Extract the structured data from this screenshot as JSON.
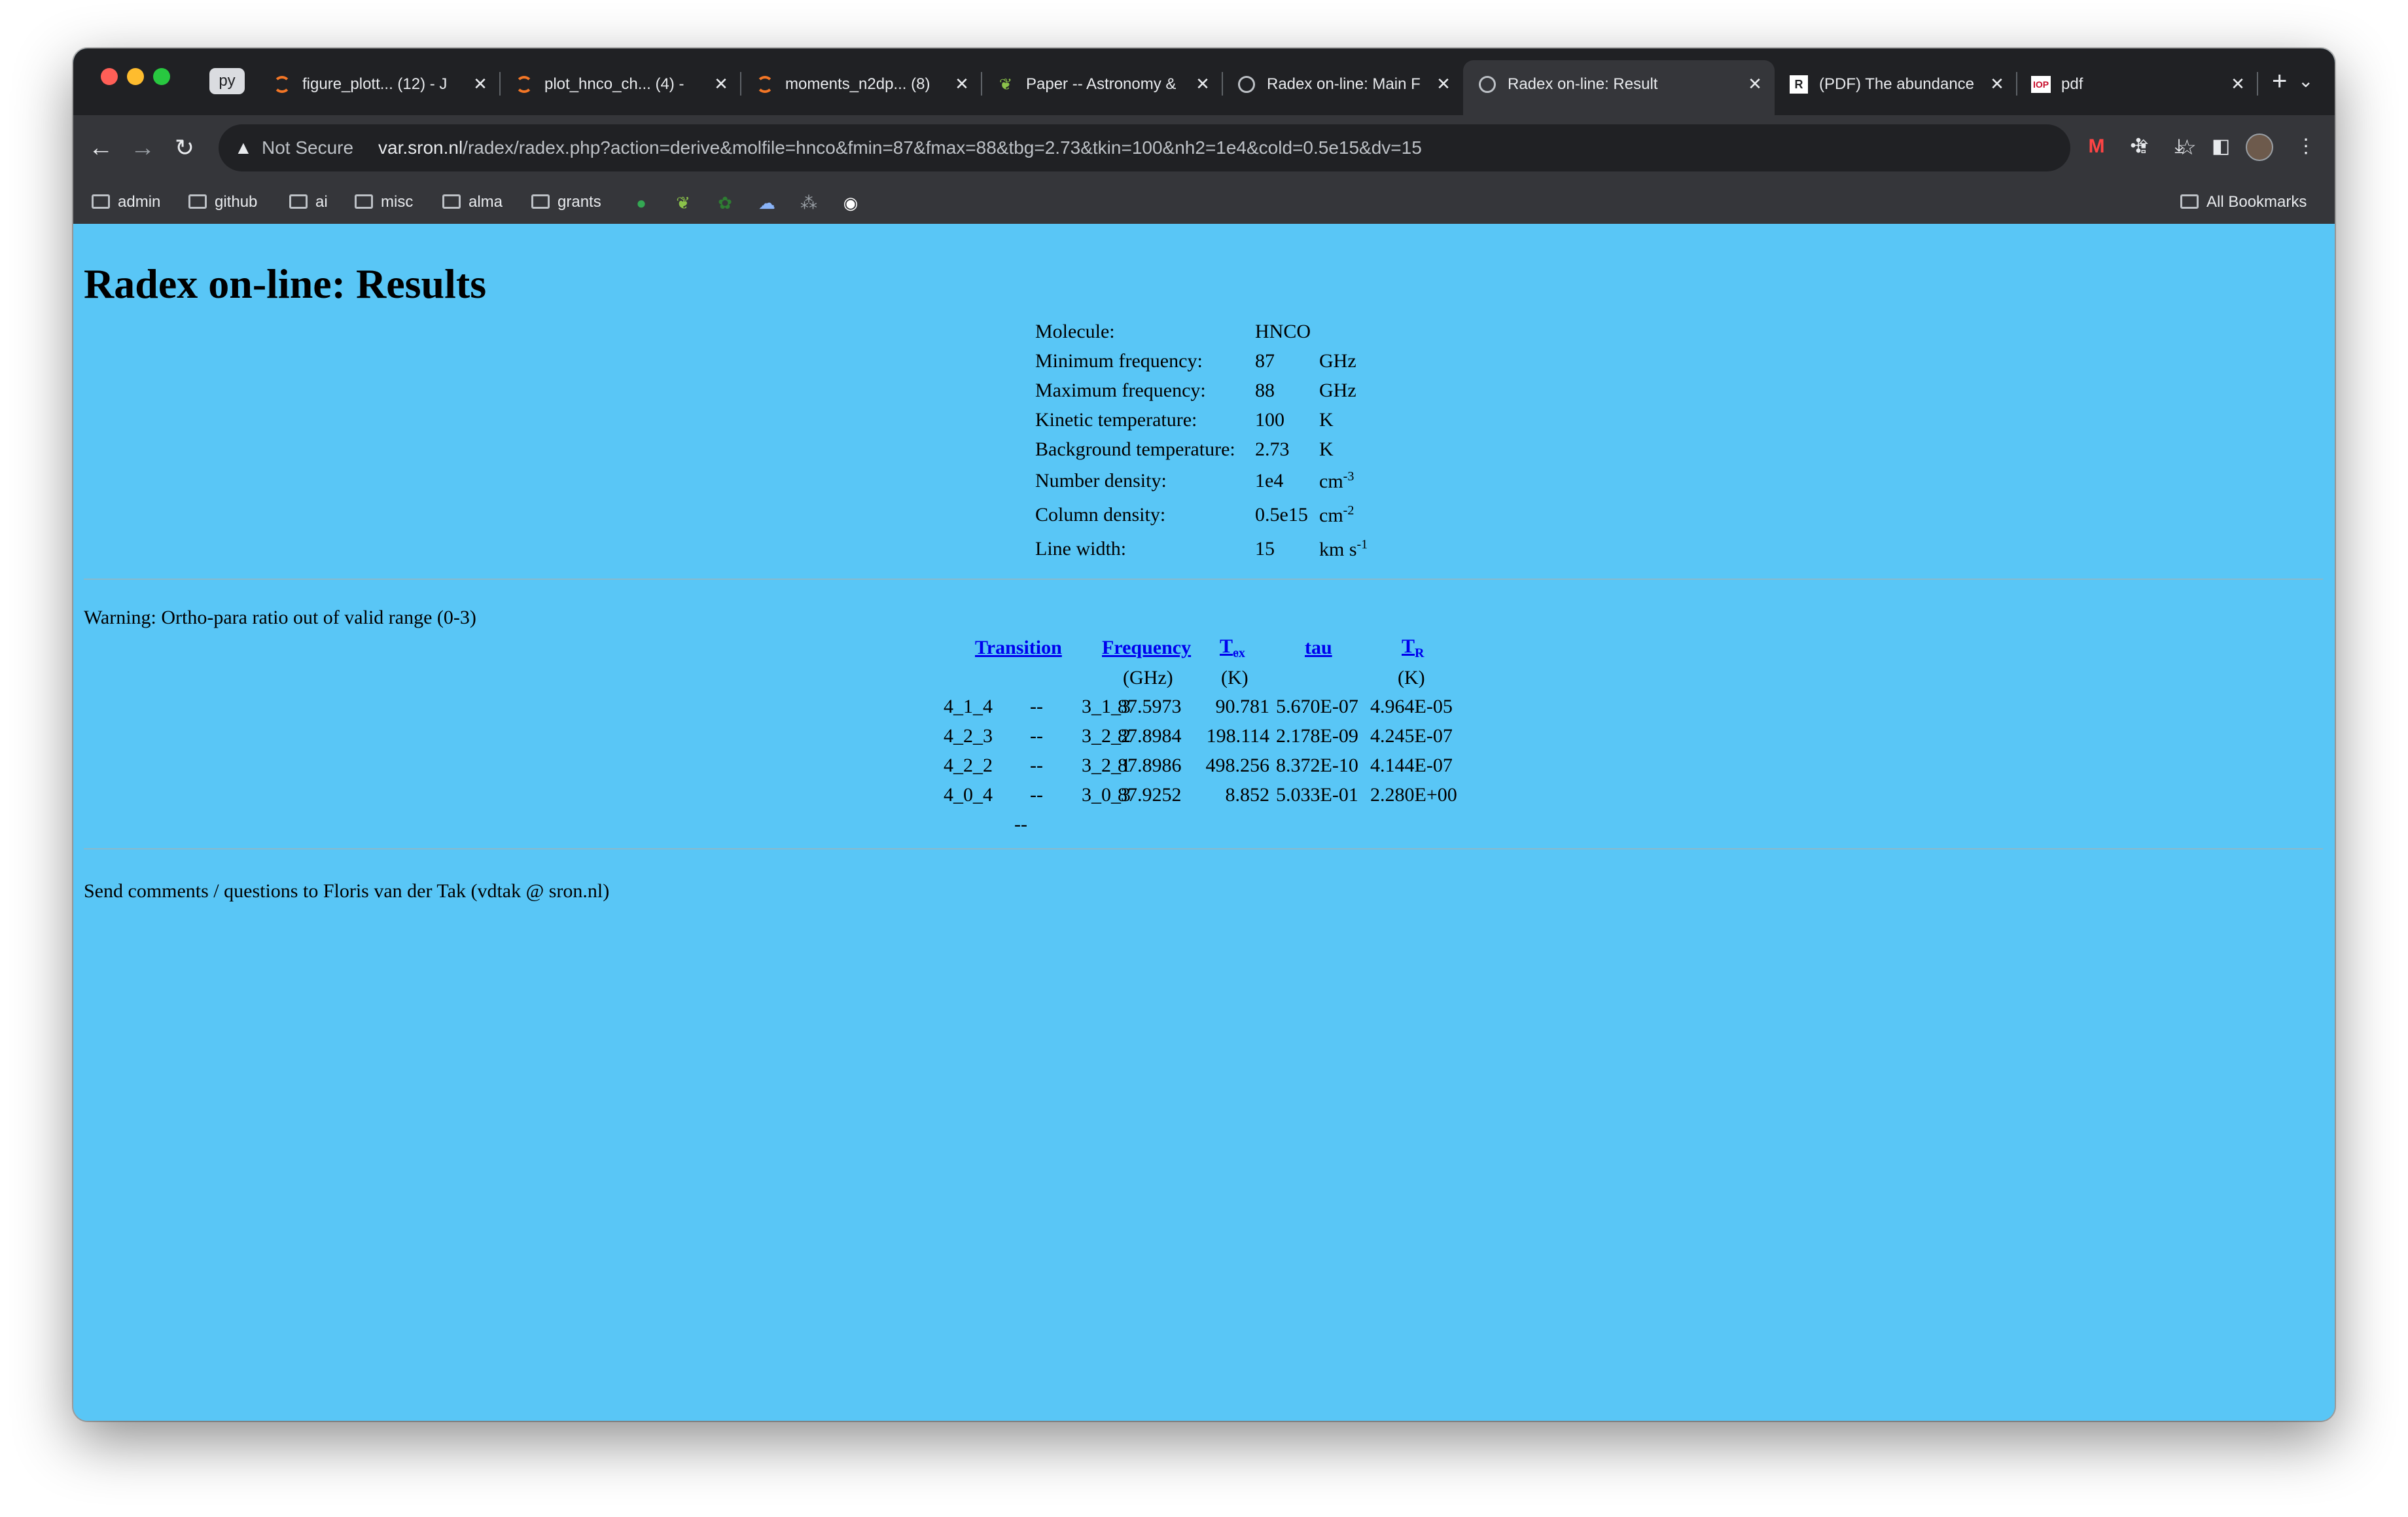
{
  "tabs": {
    "pinned_label": "py",
    "items": [
      {
        "title": "figure_plott... (12) - J",
        "icon": "jupyter-icon"
      },
      {
        "title": "plot_hnco_ch... (4) - ",
        "icon": "jupyter-icon"
      },
      {
        "title": "moments_n2dp... (8) ",
        "icon": "jupyter-icon"
      },
      {
        "title": "Paper -- Astronomy & ",
        "icon": "leaf-icon"
      },
      {
        "title": "Radex on-line: Main F",
        "icon": "globe-icon"
      },
      {
        "title": "Radex on-line: Result",
        "icon": "globe-icon"
      },
      {
        "title": "(PDF) The abundance",
        "icon": "researchgate-icon"
      },
      {
        "title": "pdf",
        "icon": "iop-icon"
      }
    ],
    "new_tab_label": "+",
    "close_glyph": "✕"
  },
  "toolbar": {
    "security_label": "Not Secure",
    "url_host": "var.sron.nl",
    "url_path": "/radex/radex.php?action=derive&molfile=hnco&fmin=87&fmax=88&tbg=2.73&tkin=100&nh2=1e4&cold=0.5e15&dv=15"
  },
  "bookmarks": {
    "folders": [
      "admin",
      "github",
      "ai",
      "misc",
      "alma",
      "grants"
    ],
    "all_bookmarks": "All Bookmarks"
  },
  "page": {
    "title": "Radex on-line: Results",
    "params": {
      "molecule_label": "Molecule:",
      "molecule_value": "HNCO",
      "fmin_label": "Minimum frequency:",
      "fmin_value": "87",
      "fmin_unit": "GHz",
      "fmax_label": "Maximum frequency:",
      "fmax_value": "88",
      "fmax_unit": "GHz",
      "tkin_label": "Kinetic temperature:",
      "tkin_value": "100",
      "tkin_unit": "K",
      "tbg_label": "Background temperature:",
      "tbg_value": "2.73",
      "tbg_unit": "K",
      "nh2_label": "Number density:",
      "nh2_value": "1e4",
      "nh2_unit": "cm",
      "nh2_exp": "-3",
      "cold_label": "Column density:",
      "cold_value": "0.5e15",
      "cold_unit": "cm",
      "cold_exp": "-2",
      "dv_label": "Line width:",
      "dv_value": "15",
      "dv_unit": "km s",
      "dv_exp": "-1"
    },
    "warning": "Warning: Ortho-para ratio out of valid range (0-3)",
    "results": {
      "headers": {
        "transition": "Transition",
        "frequency": "Frequency",
        "tex_main": "T",
        "tex_sub": "ex",
        "tau": "tau",
        "tr_main": "T",
        "tr_sub": "R"
      },
      "units": {
        "frequency": "(GHz)",
        "tex": "(K)",
        "tr": "(K)"
      },
      "rows": [
        {
          "upper": "4_1_4",
          "dash": "--",
          "lower": "3_1_3",
          "freq": "87.5973",
          "tex": "90.781",
          "tau": "5.670E-07",
          "tr": "4.964E-05"
        },
        {
          "upper": "4_2_3",
          "dash": "--",
          "lower": "3_2_2",
          "freq": "87.8984",
          "tex": "198.114",
          "tau": "2.178E-09",
          "tr": "4.245E-07"
        },
        {
          "upper": "4_2_2",
          "dash": "--",
          "lower": "3_2_1",
          "freq": "87.8986",
          "tex": "498.256",
          "tau": "8.372E-10",
          "tr": "4.144E-07"
        },
        {
          "upper": "4_0_4",
          "dash": "--",
          "lower": "3_0_3",
          "freq": "87.9252",
          "tex": "8.852",
          "tau": "5.033E-01",
          "tr": "2.280E+00"
        }
      ],
      "trailing": "--"
    },
    "footer": "Send comments / questions to Floris van der Tak (vdtak @ sron.nl)"
  }
}
